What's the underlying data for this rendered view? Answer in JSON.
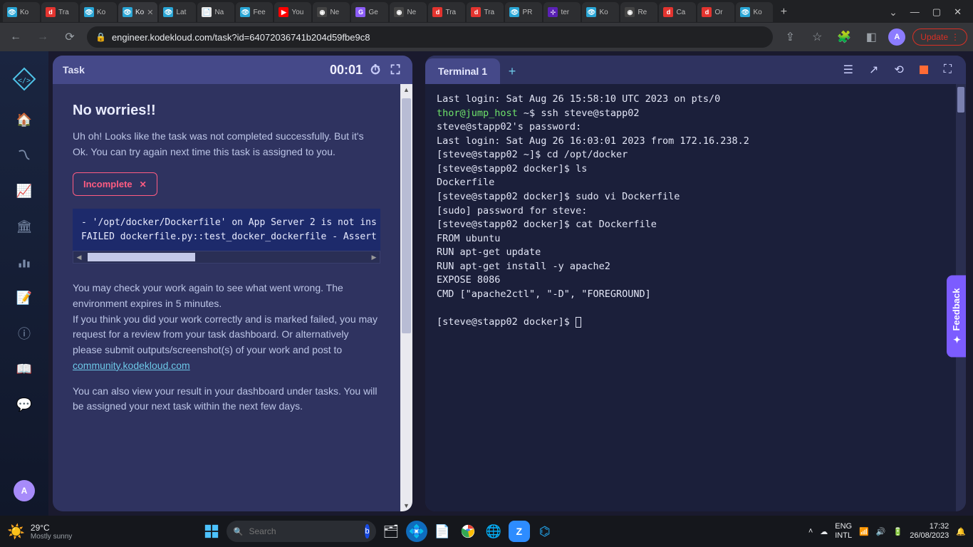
{
  "browser": {
    "tabs": [
      {
        "label": "Ko",
        "fav_bg": "#2aa6d6",
        "fav": "👁"
      },
      {
        "label": "Tra",
        "fav_bg": "#e3342f",
        "fav": "d"
      },
      {
        "label": "Ko",
        "fav_bg": "#2aa6d6",
        "fav": "👁"
      },
      {
        "label": "Ko",
        "fav_bg": "#2aa6d6",
        "fav": "👁",
        "active": true
      },
      {
        "label": "Lat",
        "fav_bg": "#2aa6d6",
        "fav": "👁"
      },
      {
        "label": "Na",
        "fav_bg": "#e8e8e8",
        "fav": "📄"
      },
      {
        "label": "Fee",
        "fav_bg": "#2aa6d6",
        "fav": "👁"
      },
      {
        "label": "You",
        "fav_bg": "#ff0000",
        "fav": "▶"
      },
      {
        "label": "Ne",
        "fav_bg": "#444",
        "fav": "◉"
      },
      {
        "label": "Ge",
        "fav_bg": "#8b5cf6",
        "fav": "G"
      },
      {
        "label": "Ne",
        "fav_bg": "#444",
        "fav": "◉"
      },
      {
        "label": "Tra",
        "fav_bg": "#e3342f",
        "fav": "d"
      },
      {
        "label": "Tra",
        "fav_bg": "#e3342f",
        "fav": "d"
      },
      {
        "label": "PR",
        "fav_bg": "#2aa6d6",
        "fav": "👁"
      },
      {
        "label": "ter",
        "fav_bg": "#5b21b6",
        "fav": "⊹"
      },
      {
        "label": "Ko",
        "fav_bg": "#2aa6d6",
        "fav": "👁"
      },
      {
        "label": "Re",
        "fav_bg": "#444",
        "fav": "◉"
      },
      {
        "label": "Ca",
        "fav_bg": "#e3342f",
        "fav": "d"
      },
      {
        "label": "Or",
        "fav_bg": "#e3342f",
        "fav": "d"
      },
      {
        "label": "Ko",
        "fav_bg": "#2aa6d6",
        "fav": "👁"
      }
    ],
    "url": "engineer.kodekloud.com/task?id=64072036741b204d59fbe9c8",
    "update_label": "Update",
    "avatar_letter": "A"
  },
  "sidebar": {
    "avatar_letter": "A"
  },
  "task": {
    "header_label": "Task",
    "timer": "00:01",
    "heading": "No worries!!",
    "intro": "Uh oh! Looks like the task was not completed successfully. But it's Ok. You can try again next time this task is assigned to you.",
    "status_label": "Incomplete",
    "error_line1": "- '/opt/docker/Dockerfile' on App Server 2 is not ins",
    "error_line2": "FAILED dockerfile.py::test_docker_dockerfile - Assert",
    "body1_a": "You may check your work again to see what went wrong. The environment expires in 5 minutes.",
    "body1_b": "If you think you did your work correctly and is marked failed, you may request for a review from your task dashboard. Or alternatively please submit outputs/screenshot(s) of your work and post to ",
    "community_link": "community.kodekloud.com",
    "body2": "You can also view your result in your dashboard under tasks. You will be assigned your next task within the next few days."
  },
  "terminal": {
    "tab_label": "Terminal 1",
    "lines": {
      "l1": "Last login: Sat Aug 26 15:58:10 UTC 2023 on pts/0",
      "prompt1_user": "thor@jump_host",
      "prompt1_rest": " ~$ ",
      "cmd1": "ssh steve@stapp02",
      "l3": "steve@stapp02's password:",
      "l4": "Last login: Sat Aug 26 16:03:01 2023 from 172.16.238.2",
      "l5": "[steve@stapp02 ~]$ cd /opt/docker",
      "l6": "[steve@stapp02 docker]$ ls",
      "l7": "Dockerfile",
      "l8": "[steve@stapp02 docker]$ sudo vi Dockerfile",
      "l9": "[sudo] password for steve:",
      "l10": "[steve@stapp02 docker]$ cat Dockerfile",
      "l11": "FROM ubuntu",
      "l12": "RUN apt-get update",
      "l13": "RUN apt-get install -y apache2",
      "l14": "EXPOSE 8086",
      "l15": "CMD [\"apache2ctl\", \"-D\", \"FOREGROUND]",
      "l16": "",
      "l17": "[steve@stapp02 docker]$ "
    }
  },
  "feedback_label": "Feedback",
  "taskbar": {
    "temp": "29°C",
    "weather_desc": "Mostly sunny",
    "search_placeholder": "Search",
    "lang1": "ENG",
    "lang2": "INTL",
    "time": "17:32",
    "date": "26/08/2023"
  }
}
